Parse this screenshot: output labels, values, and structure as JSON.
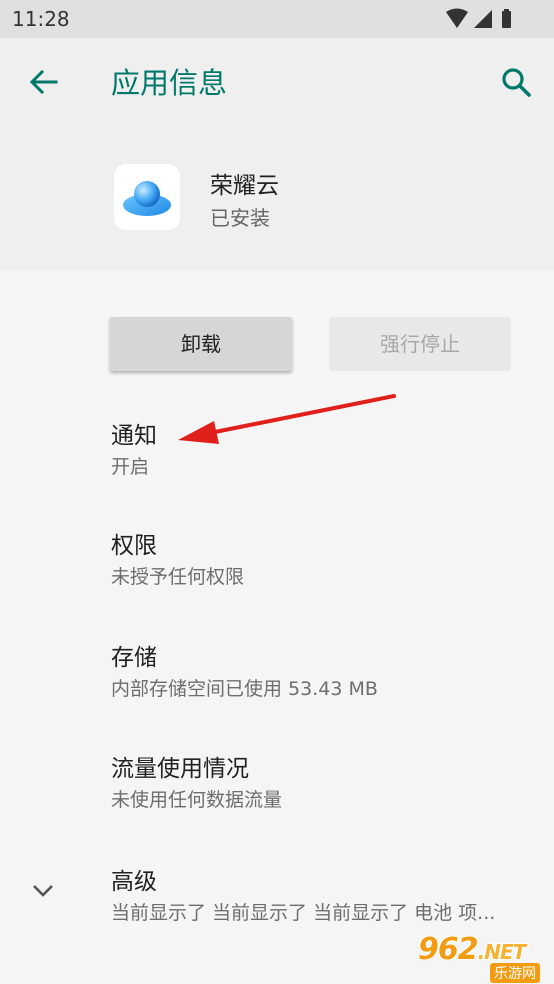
{
  "status_bar": {
    "time": "11:28"
  },
  "header": {
    "title": "应用信息"
  },
  "app": {
    "name": "荣耀云",
    "install_status": "已安装"
  },
  "buttons": {
    "uninstall": "卸载",
    "force_stop": "强行停止"
  },
  "settings": [
    {
      "title": "通知",
      "summary": "开启"
    },
    {
      "title": "权限",
      "summary": "未授予任何权限"
    },
    {
      "title": "存储",
      "summary": "内部存储空间已使用 53.43 MB"
    },
    {
      "title": "流量使用情况",
      "summary": "未使用任何数据流量"
    },
    {
      "title": "高级",
      "summary": "当前显示了 当前显示了 当前显示了 电池 项..."
    }
  ],
  "watermark": {
    "main": "962",
    "suffix": ".NET",
    "sub": "乐游网"
  },
  "colors": {
    "accent": "#00796b",
    "annotation_arrow": "#e0201b",
    "watermark": "#f39c12"
  }
}
